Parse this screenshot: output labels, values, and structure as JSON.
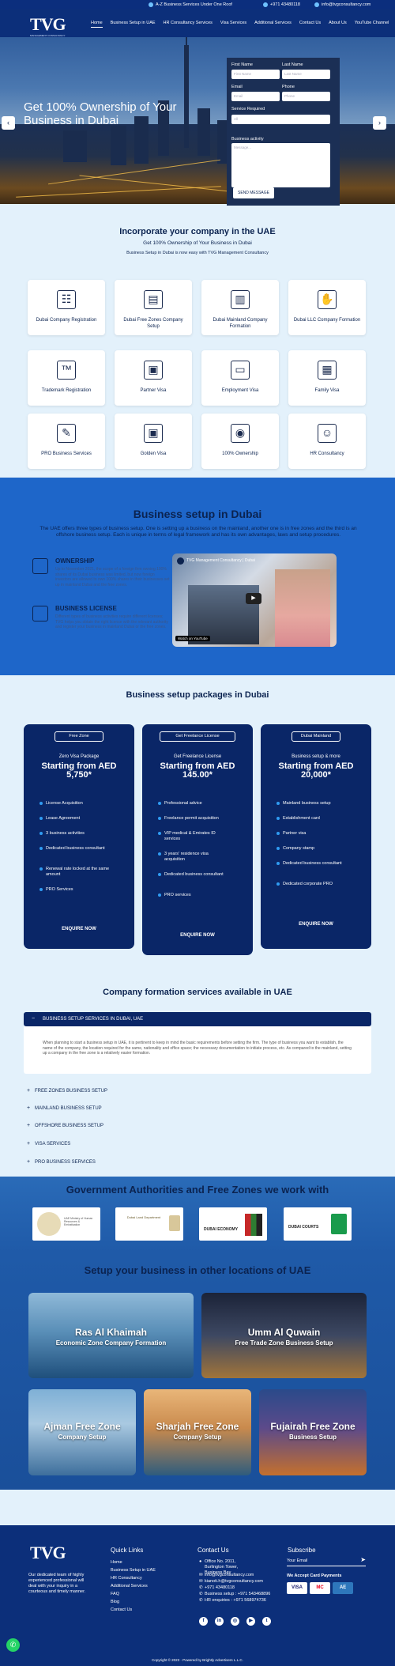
{
  "topbar": {
    "item1": "A-Z Business Services Under One Roof",
    "item2": "+971 43480118",
    "item3": "info@tvgconsultancy.com"
  },
  "header": {
    "logo": "TVG",
    "logo_sub": "MANAGEMENT CONSULTANCY",
    "nav": [
      "Home",
      "Business Setup in UAE",
      "HR Consultancy Services",
      "Visa Services",
      "Additional Services",
      "Contact Us",
      "About Us",
      "YouTube Channel"
    ]
  },
  "hero": {
    "title": "Get 100% Ownership of Your Business in Dubai",
    "prev": "‹",
    "next": "›",
    "form": {
      "first_name_label": "First Name",
      "first_name_ph": "First Name",
      "last_name_label": "Last Name",
      "last_name_ph": "Last Name",
      "email_label": "Email",
      "email_ph": "Email",
      "phone_label": "Phone",
      "phone_ph": "Phone",
      "service_label": "Service Required",
      "service_ph": "All",
      "activity_label": "Business activity",
      "activity_ph": "Message...",
      "send": "SEND MESSAGE"
    }
  },
  "incorporate": {
    "title": "Incorporate your company in the UAE",
    "subtitle": "Get 100% Ownership of Your Business in Dubai",
    "line": "Business Setup in Dubai is now easy with TVG Management Consultancy",
    "services": [
      "Dubai Company Registration",
      "Dubai Free Zones Company Setup",
      "Dubai Mainland Company Formation",
      "Dubai LLC Company Formation",
      "Trademark Registration",
      "Partner Visa",
      "Employment Visa",
      "Family Visa",
      "PRO Business Services",
      "Golden Visa",
      "100% Ownership",
      "HR Consultancy"
    ]
  },
  "business": {
    "title": "Business setup in Dubai",
    "text": "The UAE offers three types of business setup. One is setting up a business on the mainland, another one is in free zones and the third is an offshore business setup. Each is unique in terms of legal framework and has its own advantages, laws and setup procedures.",
    "f1_title": "OWNERSHIP",
    "f1_text": "Up to November 2021, the scope of a foreign firm owning 100% shares of its Dubai business was limited, but now foreign investors are allowed to own 100% shares in their businesses set up in mainland Dubai and the free zones.",
    "f2_title": "BUSINESS LICENSE",
    "f2_text": "Different types of business activities require different licenses; TVG helps you obtain the right license with the relevant authority and register your business in mainland Dubai or the free zones.",
    "video_title": "TVG Management Consultancy | Dubai",
    "video_source": "Watch on YouTube"
  },
  "packages": {
    "title": "Business setup packages in Dubai",
    "items": [
      {
        "tag": "Free Zone",
        "name": "Zero Visa Package",
        "price": "Starting from AED 5,750*",
        "features": [
          "License Acquisition",
          "Lease Agreement",
          "3 business activities",
          "Dedicated business consultant",
          "Renewal rate locked at the same amount",
          "PRO Services"
        ],
        "cta": "ENQUIRE NOW"
      },
      {
        "tag": "Get Freelance License",
        "name": "Get Freelance License",
        "price": "Starting from AED 145.00*",
        "features": [
          "Professional advice",
          "Freelance permit acquisition",
          "VIP medical & Emirates ID services",
          "3 years' residence visa acquisition",
          "Dedicated business consultant",
          "PRO services"
        ],
        "cta": "ENQUIRE NOW"
      },
      {
        "tag": "Dubai Mainland",
        "name": "Business setup & more",
        "price": "Starting from AED 20,000*",
        "features": [
          "Mainland business setup",
          "Establishment card",
          "Partner visa",
          "Company stamp",
          "Dedicated business consultant",
          "Dedicated corporate PRO"
        ],
        "cta": "ENQUIRE NOW"
      }
    ]
  },
  "formation": {
    "title": "Company formation services available in UAE",
    "open_item": "BUSINESS SETUP SERVICES IN DUBAI, UAE",
    "open_text": "When planning to start a business setup in UAE, it is pertinent to keep in mind the basic requirements before setting the firm. The type of business you want to establish, the name of the company, the location required for the same, nationality and office space; the necessary documentation to initiate process, etc. As compared to the mainland, setting up a company in the free zone is a relatively easier formation.",
    "items": [
      "FREE ZONES BUSINESS SETUP",
      "MAINLAND BUSINESS SETUP",
      "OFFSHORE BUSINESS SETUP",
      "VISA SERVICES",
      "PRO BUSINESS SERVICES"
    ]
  },
  "authorities": {
    "title": "Government Authorities and Free Zones we work with",
    "logos": [
      "UAE Ministry of Human Resources & Emiratisation",
      "Dubai Land Department",
      "DUBAI ECONOMY",
      "DUBAI COURTS"
    ]
  },
  "locations": {
    "title": "Setup your business in other locations of UAE",
    "items": [
      {
        "name": "Ras Al Khaimah",
        "sub": "Economic Zone Company Formation"
      },
      {
        "name": "Umm Al Quwain",
        "sub": "Free Trade Zone Business Setup"
      },
      {
        "name": "Ajman Free Zone",
        "sub": "Company Setup"
      },
      {
        "name": "Sharjah Free Zone",
        "sub": "Company Setup"
      },
      {
        "name": "Fujairah Free Zone",
        "sub": "Business Setup"
      }
    ]
  },
  "footer": {
    "logo": "TVG",
    "about": "Our dedicated team of highly experienced professional will deal with your inquiry in a courteous and timely manner.",
    "quick_title": "Quick Links",
    "quick": [
      "Home",
      "Business Setup in UAE",
      "HR Consultancy",
      "Additional Services",
      "FAQ",
      "Blog",
      "Contact Us"
    ],
    "contact_title": "Contact Us",
    "contact": [
      "Office No. 2011, Burlington Tower, Business Bay",
      "info@tvgconsultancy.com",
      "kianoti.h@tvgconsultancy.com",
      "+971 43480118",
      "Business setup : +971 543468896",
      "HR enquiries : +971 568974736"
    ],
    "sub_title": "Subscribe",
    "sub_ph": "Your Email",
    "payments": "We Accept Card Payments",
    "cards": [
      "VISA",
      "MC",
      "AE"
    ],
    "social": [
      "f",
      "in",
      "◎",
      "▶",
      "t"
    ],
    "copyright": "Copyright © 2023 · Powered by Brightly Advertisers L.L.C."
  }
}
